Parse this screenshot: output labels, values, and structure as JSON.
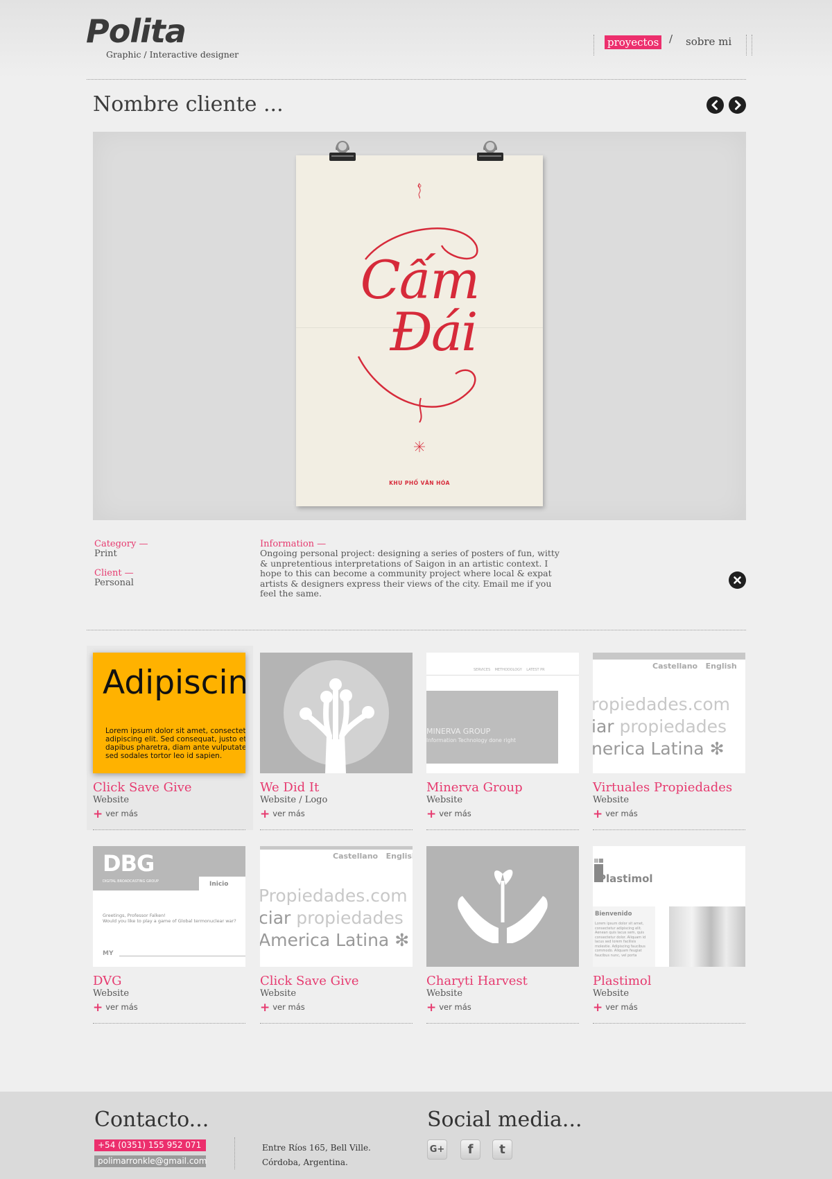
{
  "brand": {
    "logo": "Polita",
    "tagline": "Graphic / Interactive designer"
  },
  "nav": {
    "items": [
      "proyectos",
      "sobre mi"
    ]
  },
  "project": {
    "title": "Nombre cliente ...",
    "poster": {
      "line1": "Cấm",
      "line2": "Đái",
      "footer": "KHU PHỐ VĂN HÓA"
    },
    "category_label": "Category —",
    "category_value": "Print",
    "client_label": "Client —",
    "client_value": "Personal",
    "info_label": "Information —",
    "info_text": "Ongoing personal project: designing a series of posters of fun, witty & unpretentious interpretations of Saigon in an artistic context. I hope to this can become a community project where local & expat artists & designers express their views of the city. Email me if you feel the same."
  },
  "ver_mas": "ver más",
  "cards": [
    {
      "title": "Click Save Give",
      "type": "Website",
      "thumb": {
        "big": "Adipiscin",
        "text": "Lorem ipsum dolor sit amet, consectet adipiscing elit. Sed consequat, justo et dapibus pharetra, diam ante vulputate sed sodales tortor leo id sapien."
      }
    },
    {
      "title": "We Did It",
      "type": "Website / Logo"
    },
    {
      "title": "Minerva Group",
      "type": "Website",
      "thumb": {
        "nav": "SERVICES    METHODOLOGY    LATEST PR",
        "name": "MINERVA GROUP",
        "sub": "Information Technology done right"
      }
    },
    {
      "title": "Virtuales Propiedades",
      "type": "Website",
      "thumb": {
        "lang1": "Castellano",
        "lang2": "English",
        "l1": "ropiedades.com",
        "l2a": "iar",
        "l2b": "propiedades",
        "l3": "nerica Latina",
        "star": "✻"
      }
    },
    {
      "title": "DVG",
      "type": "Website",
      "thumb": {
        "logo": "DBG",
        "sub": "DIGITAL BROADCASTING GROUP",
        "tab": "Inicio",
        "greet1": "Greetings, Professor Falken!",
        "greet2": "Would you like to play a game of Global termonuclear war?",
        "my": "MY"
      }
    },
    {
      "title": "Click Save Give",
      "type": "Website",
      "thumb": {
        "lang1": "Castellano",
        "lang2": "English",
        "l1": "Propiedades.com",
        "l2a": "ciar",
        "l2b": "propiedades",
        "l3": "America Latina",
        "star": "✻"
      }
    },
    {
      "title": "Charyti Harvest",
      "type": "Website"
    },
    {
      "title": "Plastimol",
      "type": "Website",
      "thumb": {
        "logo": "Plastimol",
        "welcome": "Bienvenido",
        "body": "Lorem ipsum dolor sit amet, consectetur adipiscing elit. Aenean quis lacus sem, quis consectetur dolor. Aliquam id lacus sed lorem facilisis molestie. Adipiscing faucibus commodo. Aliquam feugiat faucibus nunc, vel porta"
      }
    }
  ],
  "contact": {
    "title": "Contacto...",
    "phone": "+54 (0351) 155 952 071",
    "email": "polimarronkle@gmail.com",
    "address1": "Entre Ríos 165, Bell Ville.",
    "address2": "Córdoba, Argentina."
  },
  "social": {
    "title": "Social media...",
    "icons": [
      "G+",
      "f",
      "t"
    ]
  },
  "colors": {
    "accent": "#ec2f6d",
    "poster_red": "#d62a3a",
    "yellow": "#ffb200"
  }
}
